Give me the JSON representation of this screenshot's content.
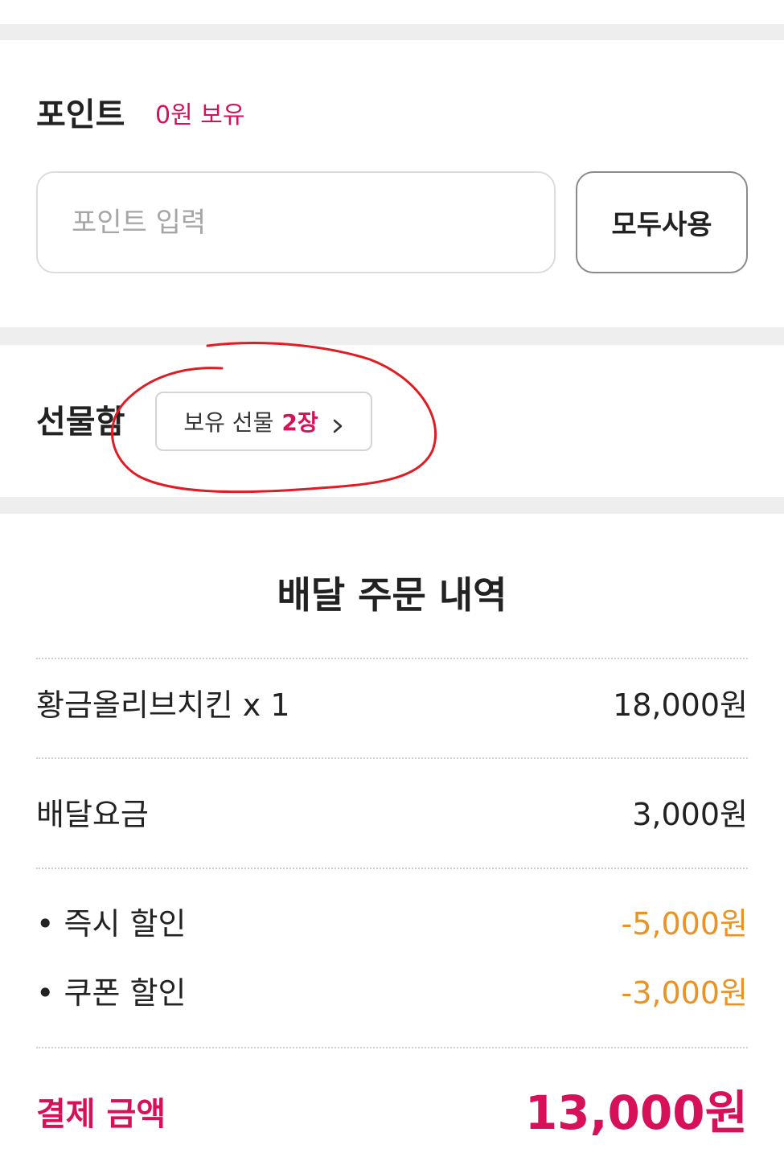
{
  "points": {
    "title": "포인트",
    "balance": "0원 보유",
    "input_placeholder": "포인트 입력",
    "input_value": "",
    "use_all_label": "모두사용"
  },
  "gift_box": {
    "title": "선물함",
    "chip_prefix": "보유 선물",
    "chip_count": "2장",
    "chip_icon": "chevron-right-icon"
  },
  "order_summary": {
    "title": "배달 주문 내역",
    "items": [
      {
        "label": "황금올리브치킨 x 1",
        "value": "18,000원"
      }
    ],
    "delivery_fee": {
      "label": "배달요금",
      "value": "3,000원"
    },
    "discounts": [
      {
        "label": "• 즉시 할인",
        "value": "-5,000원"
      },
      {
        "label": "• 쿠폰 할인",
        "value": "-3,000원"
      }
    ],
    "total": {
      "label": "결제 금액",
      "value": "13,000원"
    }
  },
  "colors": {
    "accent": "#d6115a",
    "discount": "#e89325",
    "annotation": "#e01b24",
    "band": "#eeeeee"
  }
}
